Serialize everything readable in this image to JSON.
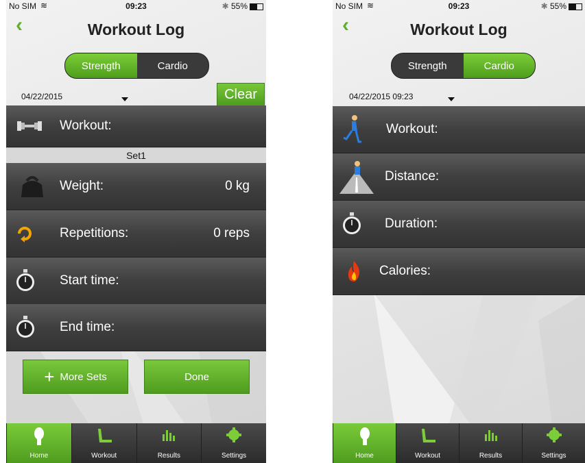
{
  "left": {
    "status": {
      "carrier": "No SIM",
      "time": "09:23",
      "battery": "55%"
    },
    "title": "Workout Log",
    "segments": {
      "strength": "Strength",
      "cardio": "Cardio",
      "selected": "Strength"
    },
    "date": "04/22/2015",
    "clear_label": "Clear",
    "workout_label": "Workout:",
    "set_label": "Set1",
    "weight": {
      "label": "Weight:",
      "value": "0 kg"
    },
    "repetitions": {
      "label": "Repetitions:",
      "value": "0 reps"
    },
    "start_time": {
      "label": "Start time:"
    },
    "end_time": {
      "label": "End time:"
    },
    "more_sets_label": "More Sets",
    "done_label": "Done",
    "tabs": [
      "Home",
      "Workout",
      "Results",
      "Settings"
    ],
    "active_tab": "Home"
  },
  "right": {
    "status": {
      "carrier": "No SIM",
      "time": "09:23",
      "battery": "55%"
    },
    "title": "Workout Log",
    "segments": {
      "strength": "Strength",
      "cardio": "Cardio",
      "selected": "Cardio"
    },
    "date": "04/22/2015 09:23",
    "rows": {
      "workout": "Workout:",
      "distance": "Distance:",
      "duration": "Duration:",
      "calories": "Calories:"
    },
    "tabs": [
      "Home",
      "Workout",
      "Results",
      "Settings"
    ],
    "active_tab": "Home"
  },
  "colors": {
    "accent_green": "#5db12a",
    "row_dark": "#3f3f3f"
  }
}
